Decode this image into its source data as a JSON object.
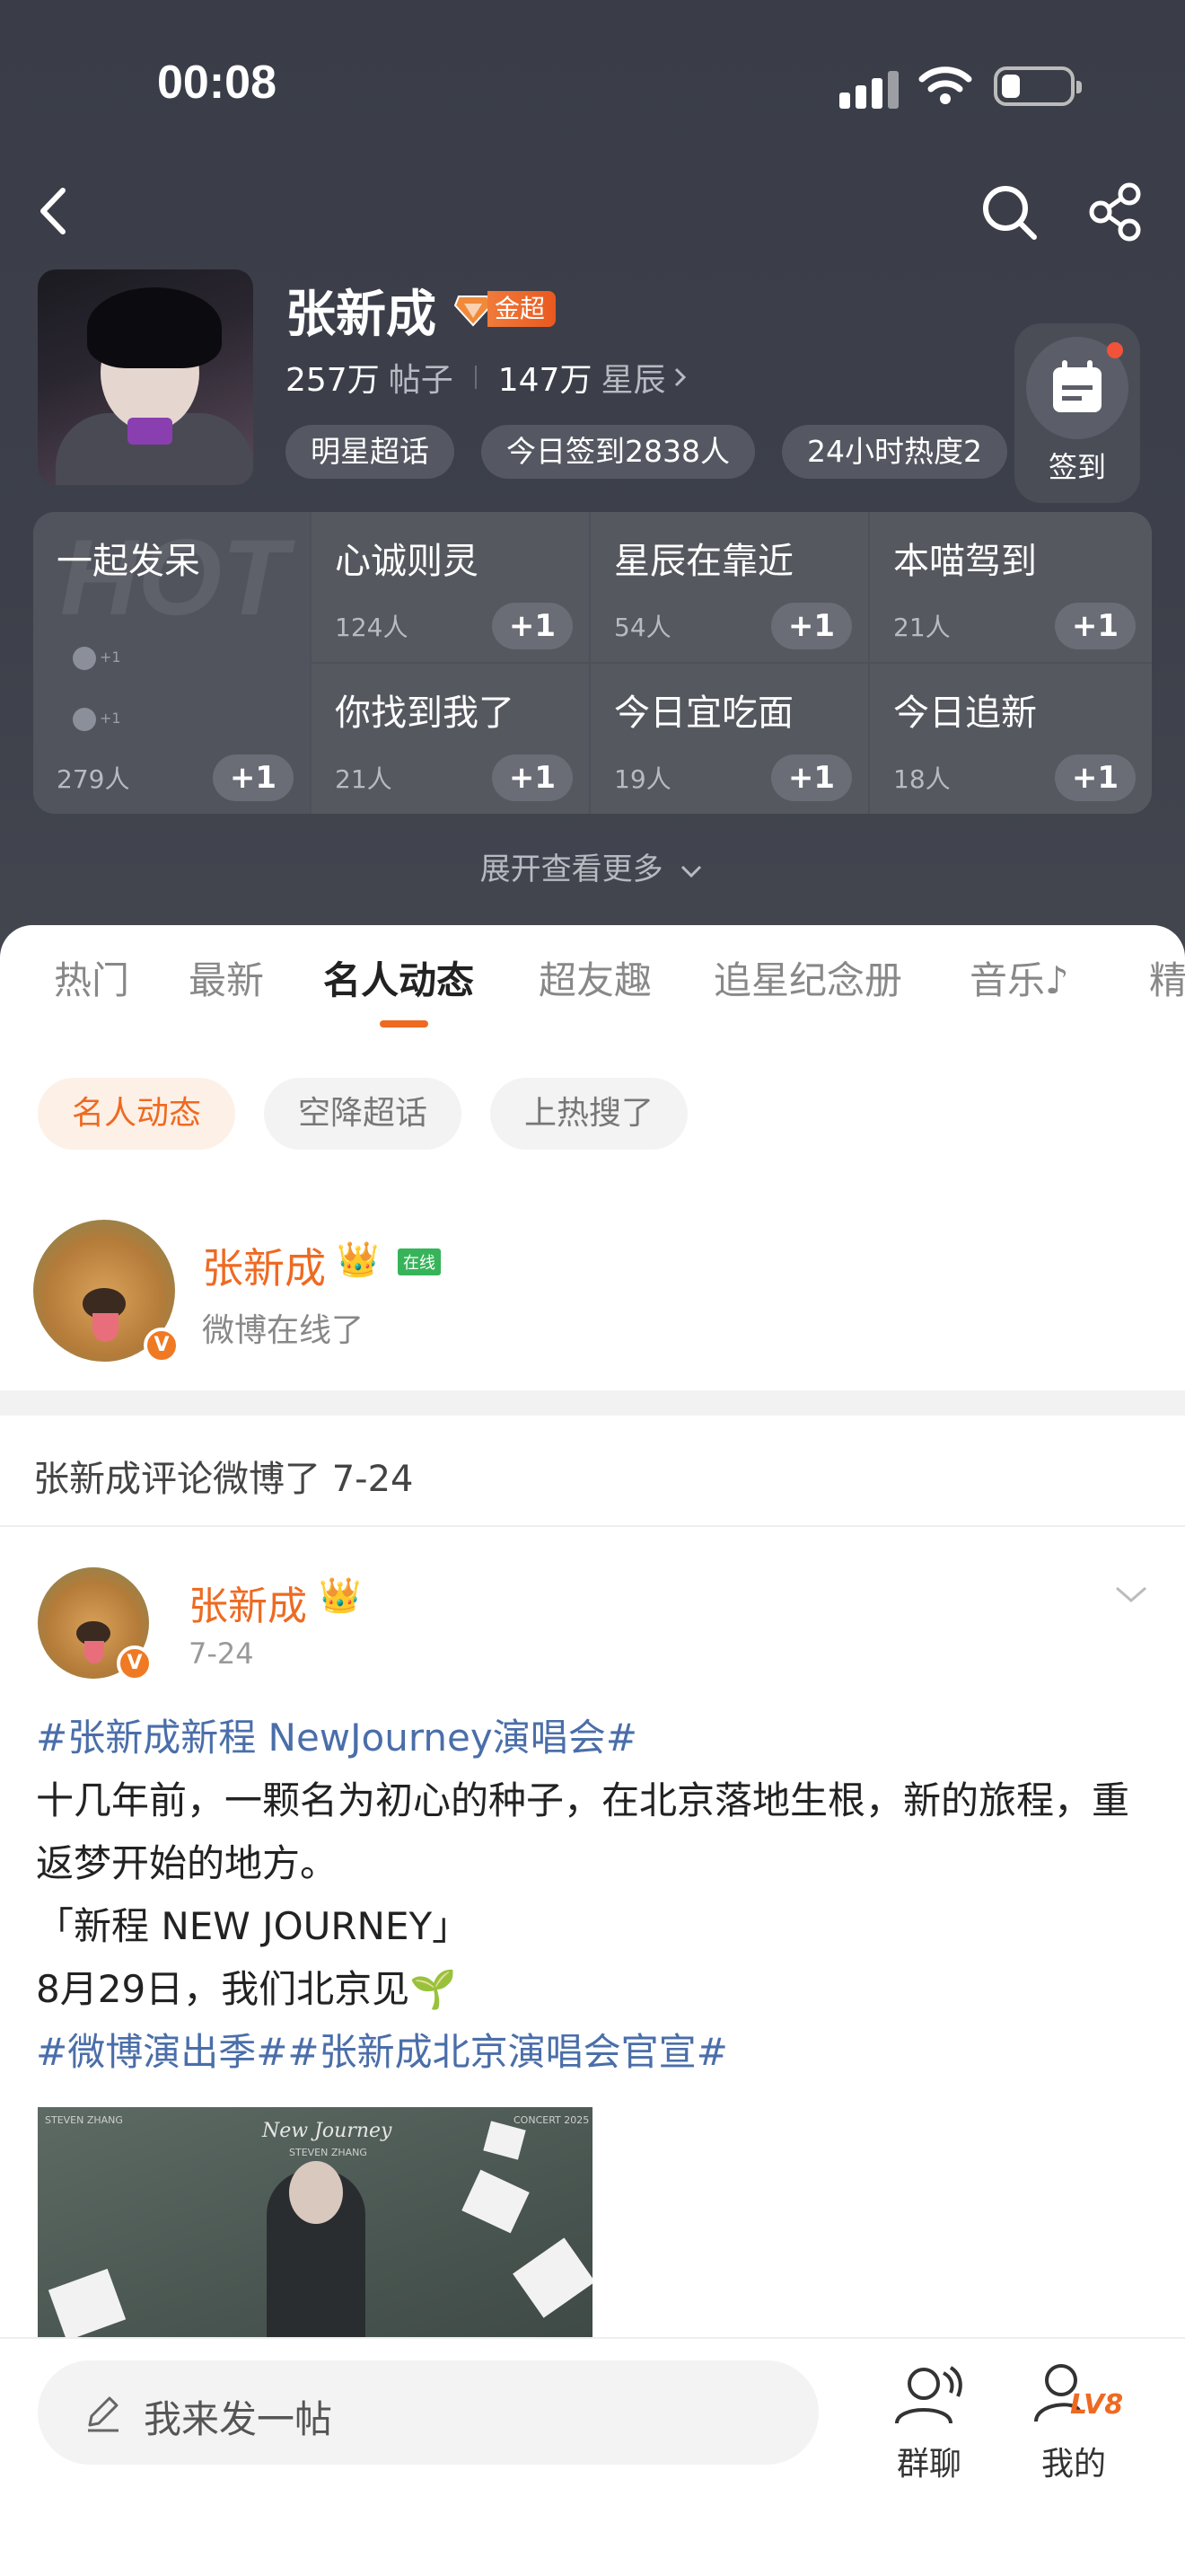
{
  "status_bar": {
    "time": "00:08"
  },
  "topic": {
    "name": "张新成",
    "badge": "金超",
    "posts_value": "257万",
    "posts_label": "帖子",
    "stars_value": "147万",
    "stars_label": "星辰",
    "chips": [
      "明星超话",
      "今日签到2838人",
      "24小时热度2"
    ],
    "checkin_label": "签到"
  },
  "grid": {
    "hot_watermark": "HOT",
    "hot_cell": {
      "title": "一起发呆",
      "count": "279人",
      "mini1": "+1",
      "mini2": "+1"
    },
    "cells": [
      {
        "title": "心诚则灵",
        "count": "124人"
      },
      {
        "title": "星辰在靠近",
        "count": "54人"
      },
      {
        "title": "本喵驾到",
        "count": "21人"
      },
      {
        "title": "你找到我了",
        "count": "21人"
      },
      {
        "title": "今日宜吃面",
        "count": "19人"
      },
      {
        "title": "今日追新",
        "count": "18人"
      }
    ],
    "plus_label": "+1"
  },
  "expand_label": "展开查看更多",
  "tabs": [
    "热门",
    "最新",
    "名人动态",
    "超友趣",
    "追星纪念册",
    "音乐♪",
    "精"
  ],
  "active_tab": "名人动态",
  "subtabs": [
    "名人动态",
    "空降超话",
    "上热搜了"
  ],
  "online_card": {
    "name": "张新成",
    "online_tag": "在线",
    "text": "微博在线了",
    "v_badge": "V"
  },
  "comment_header": "张新成评论微博了 7-24",
  "post": {
    "author": "张新成",
    "date": "7-24",
    "v_badge": "V",
    "hashtag1": "#张新成新程 NewJourney演唱会#",
    "line1": "十几年前，一颗名为初心的种子，在北京落地生根，新的旅程，重返梦开始的地方。",
    "line2": "「新程 NEW JOURNEY」",
    "line3": "8月29日，我们北京见🌱",
    "hashtags2": "#微博演出季##张新成北京演唱会官宣#",
    "image": {
      "title": "New Journey",
      "subtitle": "STEVEN ZHANG",
      "top_left": "STEVEN ZHANG",
      "top_right": "CONCERT 2025"
    }
  },
  "bottom_bar": {
    "placeholder": "我来发一帖",
    "group_label": "群聊",
    "mine_label": "我的",
    "level": "LV8"
  },
  "colors": {
    "accent": "#ee6a22",
    "hero_bg": "#3d404a",
    "hashtag": "#4a6ea9"
  }
}
